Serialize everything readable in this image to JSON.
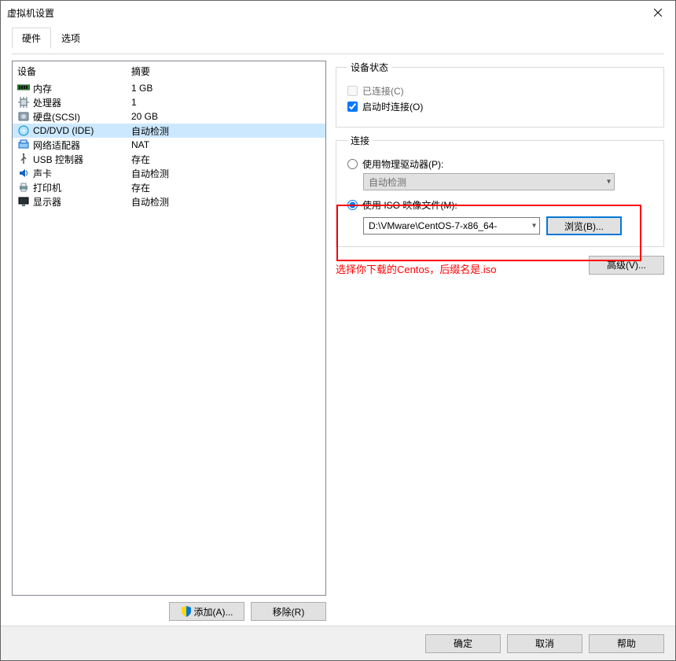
{
  "window": {
    "title": "虚拟机设置"
  },
  "tabs": {
    "hardware": "硬件",
    "options": "选项"
  },
  "device_table": {
    "col_name": "设备",
    "col_summary": "摘要",
    "rows": [
      {
        "icon": "memory-icon",
        "name": "内存",
        "summary": "1 GB"
      },
      {
        "icon": "cpu-icon",
        "name": "处理器",
        "summary": "1"
      },
      {
        "icon": "disk-icon",
        "name": "硬盘(SCSI)",
        "summary": "20 GB"
      },
      {
        "icon": "cd-icon",
        "name": "CD/DVD (IDE)",
        "summary": "自动检测"
      },
      {
        "icon": "nic-icon",
        "name": "网络适配器",
        "summary": "NAT"
      },
      {
        "icon": "usb-icon",
        "name": "USB 控制器",
        "summary": "存在"
      },
      {
        "icon": "sound-icon",
        "name": "声卡",
        "summary": "自动检测"
      },
      {
        "icon": "printer-icon",
        "name": "打印机",
        "summary": "存在"
      },
      {
        "icon": "display-icon",
        "name": "显示器",
        "summary": "自动检测"
      }
    ],
    "selected_index": 3
  },
  "left_buttons": {
    "add": "添加(A)...",
    "remove": "移除(R)"
  },
  "status_group": {
    "legend": "设备状态",
    "connected": "已连接(C)",
    "connect_at_poweron": "启动时连接(O)"
  },
  "connection_group": {
    "legend": "连接",
    "use_physical": "使用物理驱动器(P):",
    "physical_value": "自动检测",
    "use_iso": "使用 ISO 映像文件(M):",
    "iso_path": "D:\\VMware\\CentOS-7-x86_64-",
    "browse": "浏览(B)..."
  },
  "advanced": "高级(V)...",
  "annotation": "选择你下载的Centos，后缀名是.iso",
  "footer": {
    "ok": "确定",
    "cancel": "取消",
    "help": "帮助"
  }
}
